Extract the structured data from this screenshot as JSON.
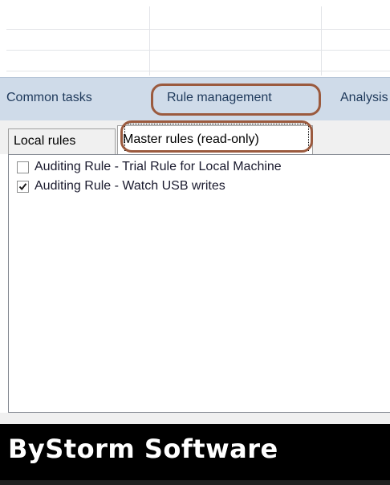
{
  "ribbon": {
    "tabs": [
      {
        "label": "Common tasks"
      },
      {
        "label": "Rule management"
      },
      {
        "label": "Analysis"
      }
    ]
  },
  "subtabs": [
    {
      "label": "Local rules"
    },
    {
      "label": "Master rules (read-only)"
    }
  ],
  "rules": [
    {
      "label": "Auditing Rule - Trial Rule for Local Machine",
      "checked": false
    },
    {
      "label": "Auditing Rule - Watch USB writes",
      "checked": true
    }
  ],
  "footer": {
    "brand": "ByStorm Software"
  },
  "colors": {
    "annotation_oval": "#9b5a3e",
    "tabstrip_bg": "#cfdbe9",
    "tab_text": "#1e395b"
  }
}
